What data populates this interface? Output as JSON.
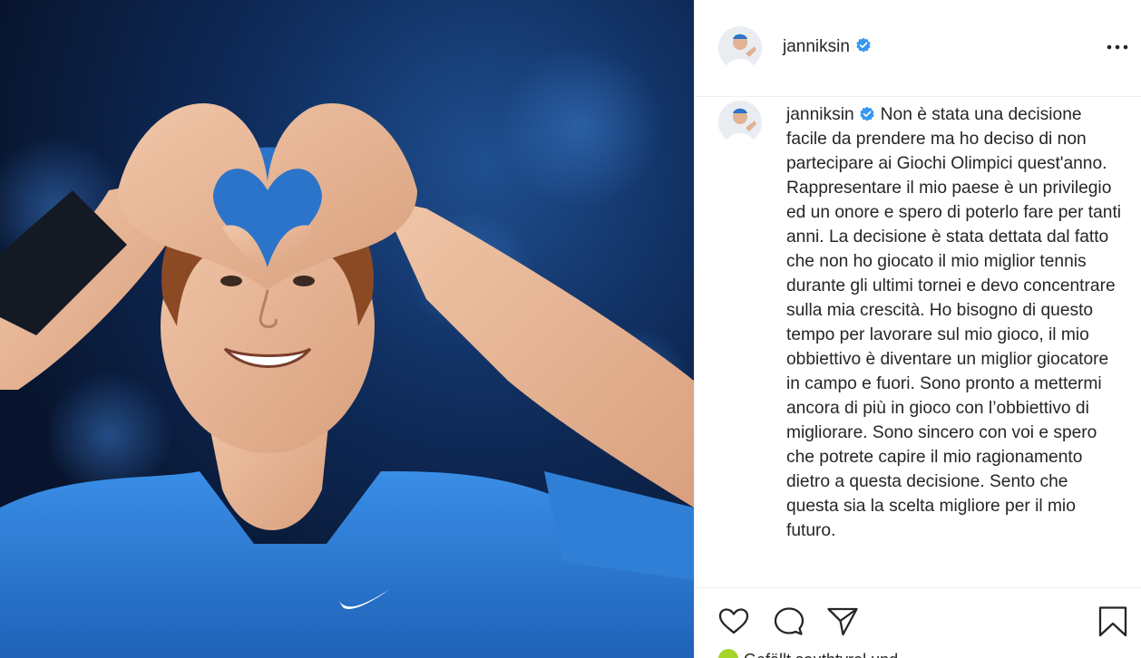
{
  "post": {
    "username": "janniksin",
    "verified": true,
    "caption_text": "Non è stata una decisione facile da prendere ma ho deciso di non partecipare ai Giochi Olimpici quest'anno. Rappresentare il mio paese è un privilegio ed un onore e spero di poterlo fare per tanti anni. La decisione è stata dettata dal fatto che non ho giocato il mio miglior tennis durante gli ultimi tornei e devo concentrare sulla mia crescità. Ho bisogno di questo tempo per lavorare sul mio gioco, il mio obbiettivo è diventare un miglior giocatore in campo e fuori. Sono pronto a mettermi ancora di più in gioco con l’obbiettivo di migliorare. Sono sincero con voi e spero che potrete capire il mio ragionamento dietro a questa decisione. Sento che questa sia la scelta migliore per il mio futuro.",
    "likes_text": "Gefällt southtyrol und"
  },
  "icons": {
    "more": "more-horizontal-icon",
    "verified": "verified-badge-icon",
    "like": "heart-icon",
    "comment": "comment-bubble-icon",
    "share": "paper-plane-icon",
    "save": "bookmark-icon"
  },
  "colors": {
    "verified": "#3897f0",
    "text": "#262626",
    "divider": "#efefef",
    "likes_avatar": "#a4d32a",
    "photo_bg": "#0f2c5c",
    "shirt": "#2f7fd6"
  }
}
